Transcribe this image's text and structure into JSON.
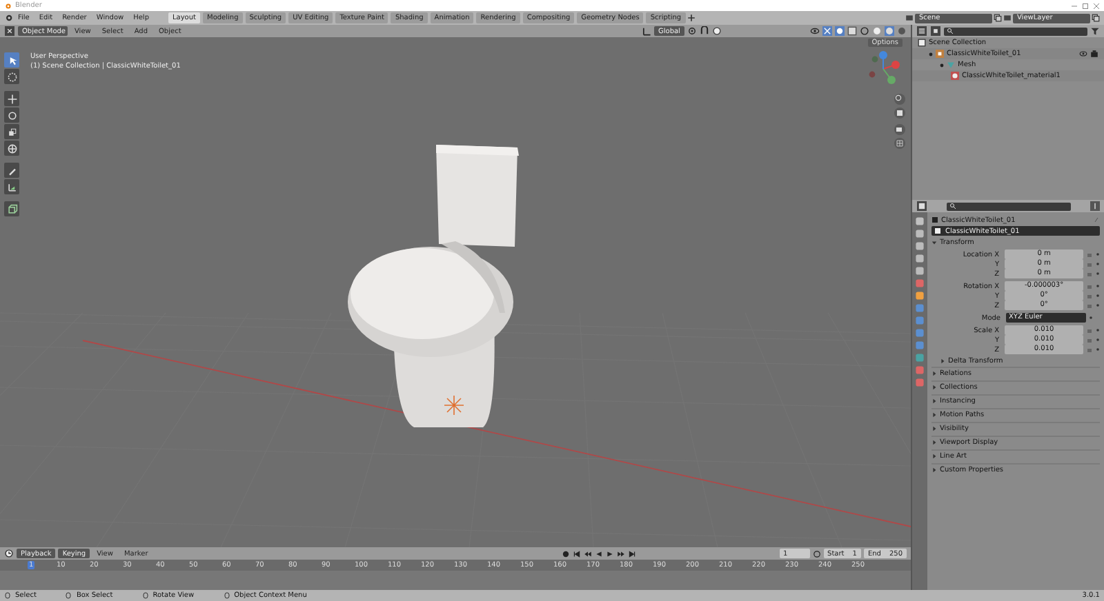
{
  "window": {
    "title": "Blender"
  },
  "menu": [
    "File",
    "Edit",
    "Render",
    "Window",
    "Help"
  ],
  "workspaces": [
    {
      "label": "Layout",
      "selected": true
    },
    {
      "label": "Modeling",
      "selected": false
    },
    {
      "label": "Sculpting",
      "selected": false
    },
    {
      "label": "UV Editing",
      "selected": false
    },
    {
      "label": "Texture Paint",
      "selected": false
    },
    {
      "label": "Shading",
      "selected": false
    },
    {
      "label": "Animation",
      "selected": false
    },
    {
      "label": "Rendering",
      "selected": false
    },
    {
      "label": "Compositing",
      "selected": false
    },
    {
      "label": "Geometry Nodes",
      "selected": false
    },
    {
      "label": "Scripting",
      "selected": false
    }
  ],
  "scene": "Scene",
  "view_layer": "ViewLayer",
  "viewport": {
    "mode": "Object Mode",
    "menus": [
      "View",
      "Select",
      "Add",
      "Object"
    ],
    "orientation": "Global",
    "options": "Options",
    "overlay_lines": [
      "User Perspective",
      "(1) Scene Collection | ClassicWhiteToilet_01"
    ],
    "tools": [
      {
        "kind": "select",
        "selected": true
      },
      {
        "kind": "cursor",
        "selected": false
      },
      {
        "kind": "move",
        "selected": false
      },
      {
        "kind": "rotate",
        "selected": false
      },
      {
        "kind": "scale",
        "selected": false
      },
      {
        "kind": "transform",
        "selected": false
      },
      {
        "kind": "annotate",
        "selected": false
      },
      {
        "kind": "measure",
        "selected": false
      },
      {
        "kind": "add-cube",
        "selected": false
      }
    ]
  },
  "outliner": {
    "tree": [
      {
        "label": "Scene Collection",
        "kind": "collection",
        "children": [
          {
            "label": "ClassicWhiteToilet_01",
            "kind": "object",
            "children": [
              {
                "label": "Mesh",
                "kind": "mesh",
                "children": [
                  {
                    "label": "ClassicWhiteToilet_material1",
                    "kind": "material"
                  }
                ]
              }
            ]
          }
        ]
      }
    ]
  },
  "properties": {
    "object_name": "ClassicWhiteToilet_01",
    "datablock": "ClassicWhiteToilet_01",
    "transform": {
      "title": "Transform",
      "expanded": true,
      "groups": [
        [
          {
            "kind": "number",
            "label": "Location X",
            "value": "0 m"
          },
          {
            "kind": "number",
            "label": "Y",
            "value": "0 m"
          },
          {
            "kind": "number",
            "label": "Z",
            "value": "0 m"
          }
        ],
        [
          {
            "kind": "number",
            "label": "Rotation X",
            "value": "-0.000003°"
          },
          {
            "kind": "number",
            "label": "Y",
            "value": "0°"
          },
          {
            "kind": "number",
            "label": "Z",
            "value": "0°"
          }
        ],
        [
          {
            "kind": "dropdown",
            "label": "Mode",
            "value": "XYZ Euler"
          }
        ],
        [
          {
            "kind": "number",
            "label": "Scale X",
            "value": "0.010"
          },
          {
            "kind": "number",
            "label": "Y",
            "value": "0.010"
          },
          {
            "kind": "number",
            "label": "Z",
            "value": "0.010"
          }
        ]
      ],
      "subpanel": {
        "title": "Delta Transform",
        "expanded": false
      }
    },
    "sections": [
      {
        "title": "Relations",
        "expanded": false
      },
      {
        "title": "Collections",
        "expanded": false
      },
      {
        "title": "Instancing",
        "expanded": false
      },
      {
        "title": "Motion Paths",
        "expanded": false
      },
      {
        "title": "Visibility",
        "expanded": false
      },
      {
        "title": "Viewport Display",
        "expanded": false
      },
      {
        "title": "Line Art",
        "expanded": false
      },
      {
        "title": "Custom Properties",
        "expanded": false
      }
    ]
  },
  "timeline": {
    "menus": [
      "Playback",
      "Keying",
      "View",
      "Marker"
    ],
    "current_frame": "1",
    "start_label": "Start",
    "start": "1",
    "end_label": "End",
    "end": "250",
    "ticks": [
      "1",
      "10",
      "20",
      "30",
      "40",
      "50",
      "60",
      "70",
      "80",
      "90",
      "100",
      "110",
      "120",
      "130",
      "140",
      "150",
      "160",
      "170",
      "180",
      "190",
      "200",
      "210",
      "220",
      "230",
      "240",
      "250"
    ]
  },
  "status_bar": {
    "items": [
      "Select",
      "Box Select",
      "Rotate View",
      "Object Context Menu"
    ],
    "version": "3.0.1"
  }
}
